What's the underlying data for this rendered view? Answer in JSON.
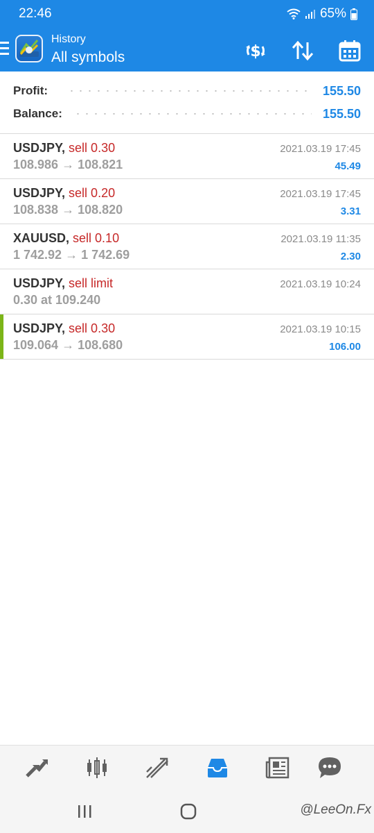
{
  "status_bar": {
    "time": "22:46",
    "battery": "65%"
  },
  "app_bar": {
    "subtitle": "History",
    "title": "All symbols"
  },
  "summary": {
    "profit_label": "Profit:",
    "profit_value": "155.50",
    "balance_label": "Balance:",
    "balance_value": "155.50"
  },
  "trades": [
    {
      "symbol": "USDJPY",
      "action": "sell 0.30",
      "prices": "108.986 → 108.821",
      "date": "2021.03.19 17:45",
      "profit": "45.49"
    },
    {
      "symbol": "USDJPY",
      "action": "sell 0.20",
      "prices": "108.838 → 108.820",
      "date": "2021.03.19 17:45",
      "profit": "3.31"
    },
    {
      "symbol": "XAUUSD",
      "action": "sell 0.10",
      "prices": "1 742.92 → 1 742.69",
      "date": "2021.03.19 11:35",
      "profit": "2.30"
    },
    {
      "symbol": "USDJPY",
      "action": "sell limit",
      "prices": "0.30 at 109.240",
      "date": "2021.03.19 10:24",
      "profit": ""
    },
    {
      "symbol": "USDJPY",
      "action": "sell 0.30",
      "prices": "109.064 → 108.680",
      "date": "2021.03.19 10:15",
      "profit": "106.00"
    }
  ],
  "bottom_nav": {
    "items": [
      "quotes-icon",
      "chart-icon",
      "trade-icon",
      "history-icon",
      "news-icon",
      "chat-icon"
    ],
    "active": "history-icon"
  },
  "watermark": "@LeeOn.Fx",
  "colors": {
    "header": "#1e88e5",
    "sell": "#c62828",
    "value": "#1e88e5",
    "highlight": "#7cb518"
  }
}
